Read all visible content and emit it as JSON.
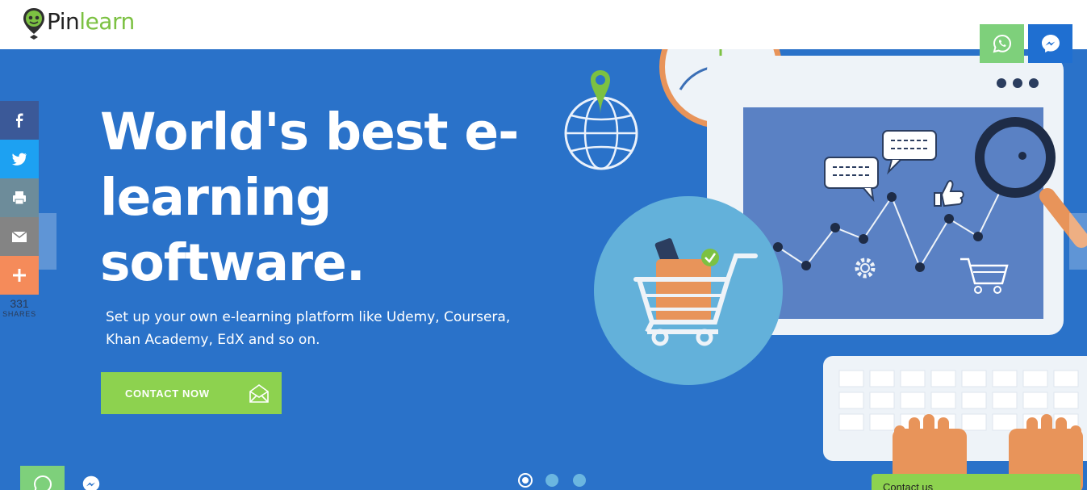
{
  "brand": {
    "name_prefix": "Pin",
    "name_suffix": "learn",
    "colors": {
      "accent_green": "#8dd24f",
      "hero_blue": "#2a72c9",
      "logo_green": "#7cc142"
    }
  },
  "hero": {
    "headline_lines": [
      "World's best e-",
      "learning",
      "software."
    ],
    "subtext": "Set up your own e-learning platform like Udemy, Coursera, Khan Academy, EdX and so on.",
    "cta_label": "CONTACT NOW",
    "cta_icon": "envelope-open-icon",
    "slides": {
      "count": 3,
      "active": 1
    }
  },
  "share": {
    "buttons": [
      {
        "name": "facebook",
        "icon": "facebook-icon",
        "color": "#3b5998"
      },
      {
        "name": "twitter",
        "icon": "twitter-icon",
        "color": "#1da1f2"
      },
      {
        "name": "print",
        "icon": "print-icon",
        "color": "#6d8c9a"
      },
      {
        "name": "email",
        "icon": "email-icon",
        "color": "#848484"
      },
      {
        "name": "more",
        "icon": "plus-icon",
        "color": "#f58b5a"
      }
    ],
    "count": "331",
    "count_label": "SHARES"
  },
  "chat": {
    "whatsapp_icon": "whatsapp-icon",
    "messenger_icon": "messenger-icon",
    "whatsapp_color": "#7ed07b",
    "messenger_color": "#1f6fd1",
    "contact_tab_label": "Contact us"
  }
}
